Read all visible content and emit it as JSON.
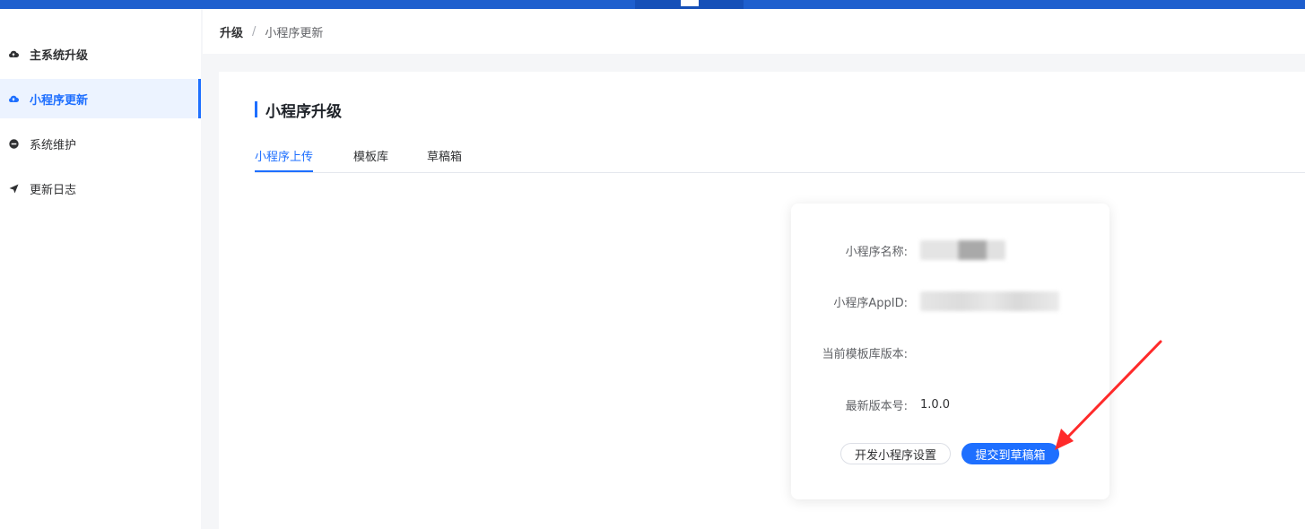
{
  "colors": {
    "accent": "#1e6fff",
    "topbar": "#1e5fce",
    "annotation_arrow": "#ff2a2a"
  },
  "sidebar": {
    "items": [
      {
        "label": "主系统升级",
        "icon": "cloud-icon",
        "active": false
      },
      {
        "label": "小程序更新",
        "icon": "cloud-icon",
        "active": true
      },
      {
        "label": "系统维护",
        "icon": "minus-circle-icon",
        "active": false
      },
      {
        "label": "更新日志",
        "icon": "paper-plane-icon",
        "active": false
      }
    ]
  },
  "breadcrumb": {
    "root": "升级",
    "separator": "/",
    "current": "小程序更新"
  },
  "section": {
    "title": "小程序升级"
  },
  "tabs": [
    {
      "label": "小程序上传",
      "active": true
    },
    {
      "label": "模板库",
      "active": false
    },
    {
      "label": "草稿箱",
      "active": false
    }
  ],
  "form": {
    "name_label": "小程序名称:",
    "appid_label": "小程序AppID:",
    "template_version_label": "当前模板库版本:",
    "template_version_value": "",
    "latest_version_label": "最新版本号:",
    "latest_version_value": "1.0.0"
  },
  "buttons": {
    "dev_settings": "开发小程序设置",
    "submit_draft": "提交到草稿箱"
  }
}
